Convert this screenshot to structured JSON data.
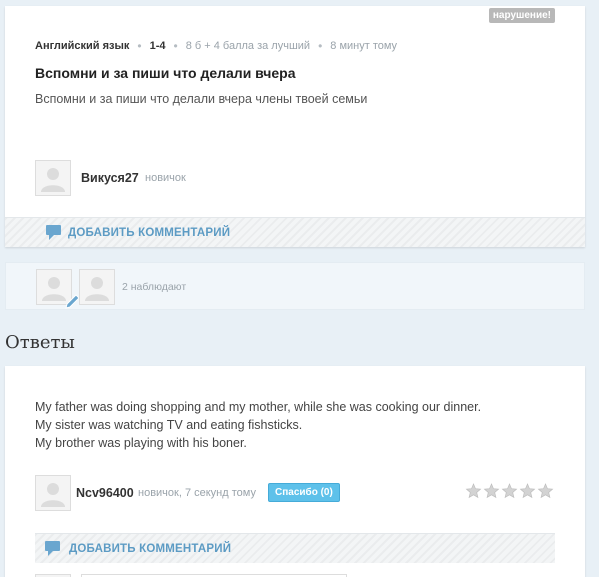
{
  "question": {
    "report_label": "нарушение!",
    "subject": "Английский язык",
    "grade": "1-4",
    "points": "8 б + 4 балла за лучший",
    "time": "8 минут тому",
    "title": "Вспомни и за пиши что делали вчера",
    "body": "Вспомни и за пиши что делали вчера члены твоей семьи",
    "author": {
      "name": "Викуся27",
      "rank": "новичок"
    },
    "add_comment_label": "ДОБАВИТЬ КОММЕНТАРИЙ"
  },
  "watchers": {
    "label": "2 наблюдают"
  },
  "answers_heading": "Ответы",
  "answer": {
    "lines": [
      "My father was doing shopping and my mother, while she was cooking our dinner.",
      "My sister was watching TV and eating fishsticks.",
      "My brother was playing with his boner."
    ],
    "author": {
      "name": "Ncv96400",
      "meta": "новичок, 7 секунд тому"
    },
    "thanks_label": "Спасибо (0)",
    "rating": 0,
    "rating_max": 5,
    "add_comment_label": "ДОБАВИТЬ КОММЕНТАРИЙ"
  },
  "colors": {
    "accent": "#5c9bc4",
    "thanks_button": "#5ec1ea",
    "background": "#e8f0f6",
    "report_badge": "#b8b8b8"
  },
  "icons": [
    "comment-icon",
    "pencil-icon",
    "user-avatar-placeholder",
    "star-icon"
  ]
}
